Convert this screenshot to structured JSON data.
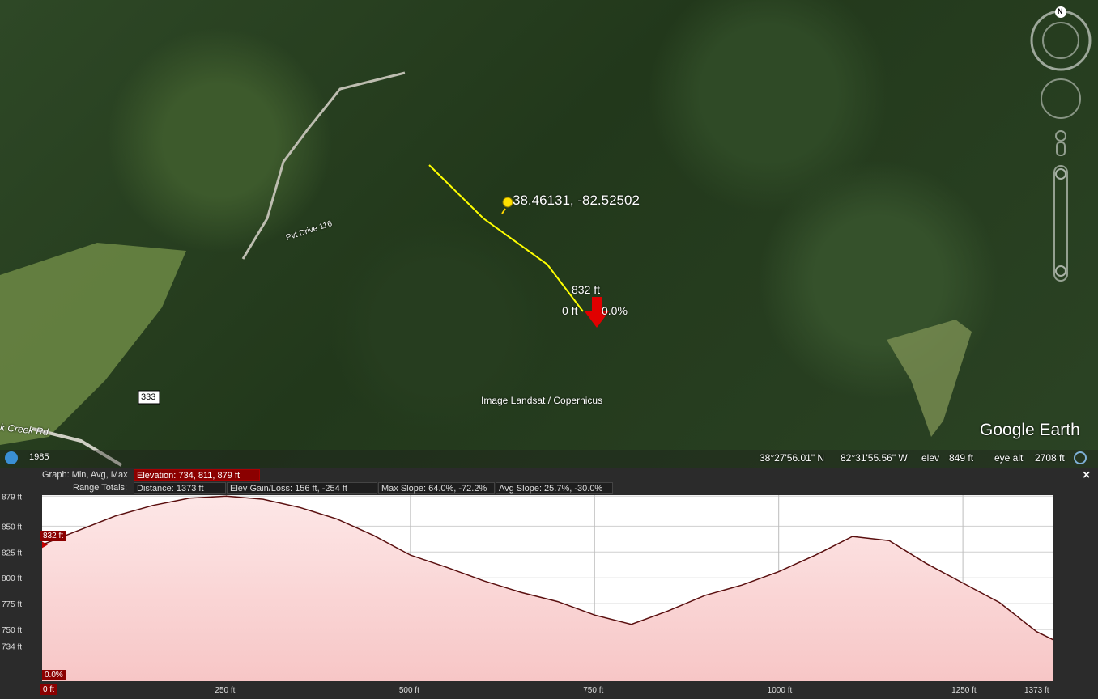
{
  "map": {
    "coordinate_label": "38.46131, -82.52502",
    "road_label": "Pvt Drive 116",
    "road_fragment": "k Creek Rd",
    "route_shield": "333",
    "marker_elev": "832 ft",
    "marker_dist": "0 ft",
    "marker_slope": "0.0%",
    "imagery_credit": "Image Landsat / Copernicus",
    "brand": "Google Earth",
    "compass_label": "N",
    "history_year": "1985"
  },
  "status": {
    "lat": "38°27'56.01\" N",
    "lon": "82°31'55.56\" W",
    "elev_label": "elev",
    "elev_value": "849 ft",
    "eye_alt_label": "eye alt",
    "eye_alt_value": "2708 ft"
  },
  "profile": {
    "graph_label": "Graph: Min, Avg, Max",
    "elevation_box": "Elevation: 734, 811, 879 ft",
    "range_label": "Range Totals:",
    "distance_box": "Distance: 1373 ft",
    "gain_box": "Elev Gain/Loss: 156 ft, -254 ft",
    "max_slope_box": "Max Slope: 64.0%, -72.2%",
    "avg_slope_box": "Avg Slope: 25.7%, -30.0%",
    "close_label": "×",
    "cursor_elev_tag": "832 ft",
    "cursor_slope_tag": "0.0%",
    "cursor_dist_tag": "0 ft"
  },
  "chart_data": {
    "type": "area",
    "x": [
      0,
      50,
      100,
      150,
      200,
      250,
      300,
      350,
      400,
      450,
      500,
      550,
      600,
      650,
      700,
      750,
      800,
      850,
      900,
      950,
      1000,
      1050,
      1100,
      1150,
      1200,
      1250,
      1300,
      1350,
      1373
    ],
    "y": [
      832,
      846,
      860,
      870,
      877,
      879,
      876,
      868,
      857,
      841,
      822,
      810,
      797,
      786,
      777,
      764,
      755,
      768,
      783,
      793,
      806,
      822,
      840,
      836,
      814,
      795,
      776,
      748,
      740
    ],
    "ylim": [
      700,
      880
    ],
    "y_ticks": [
      879,
      850,
      825,
      800,
      775,
      750,
      734
    ],
    "y_tick_labels": [
      "879 ft",
      "850 ft",
      "825 ft",
      "800 ft",
      "775 ft",
      "750 ft",
      "734 ft"
    ],
    "x_ticks": [
      250,
      500,
      750,
      1000,
      1250,
      1373
    ],
    "x_tick_labels": [
      "250 ft",
      "500 ft",
      "750 ft",
      "1000 ft",
      "1250 ft",
      "1373 ft"
    ],
    "xlim": [
      0,
      1373
    ],
    "grid": true,
    "fill_color": "#f7c6c6",
    "line_color": "#5a0f0f"
  }
}
